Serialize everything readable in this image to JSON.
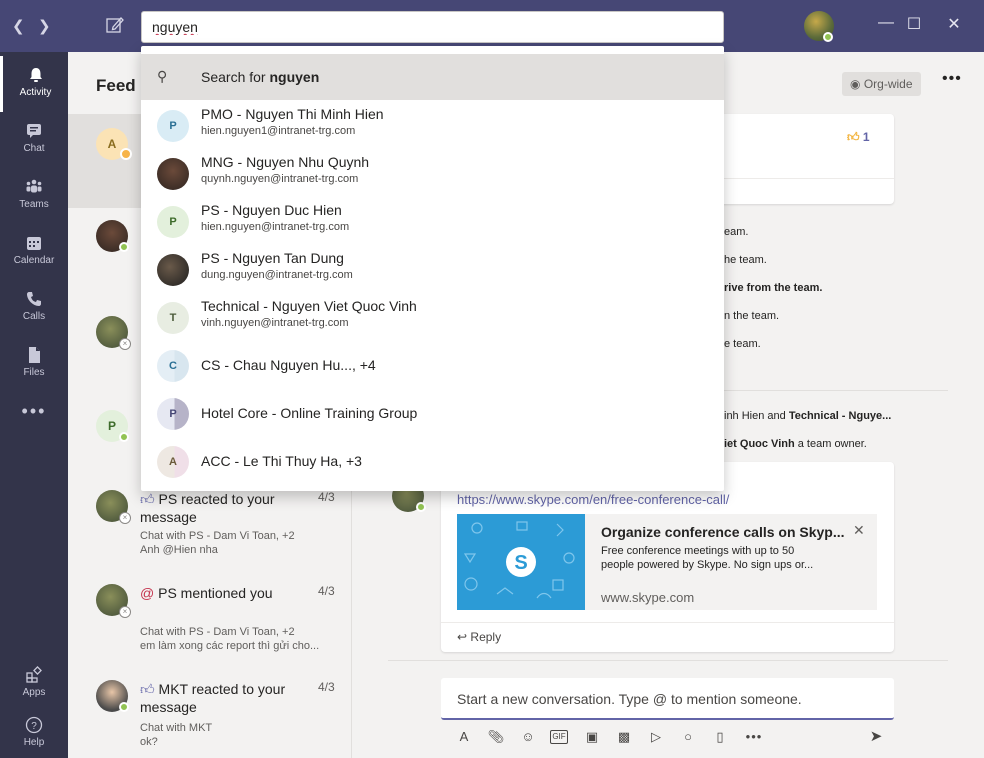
{
  "search": {
    "value": "nguyen"
  },
  "rail": [
    {
      "label": "Activity"
    },
    {
      "label": "Chat"
    },
    {
      "label": "Teams"
    },
    {
      "label": "Calendar"
    },
    {
      "label": "Calls"
    },
    {
      "label": "Files"
    },
    {
      "label": "Apps"
    },
    {
      "label": "Help"
    }
  ],
  "feed": {
    "title": "Feed",
    "items": [
      {
        "initial": "A",
        "title": "",
        "time": "",
        "sub1": "",
        "sub2": ""
      },
      {
        "initial": "",
        "title": "",
        "time": "",
        "sub1": "",
        "sub2": ""
      },
      {
        "initial": "",
        "title": "",
        "time": "",
        "sub1": "",
        "sub2": ""
      },
      {
        "initial": "P",
        "title": "",
        "time": "",
        "sub1": "",
        "sub2": ""
      },
      {
        "initial": "",
        "title": "PS reacted to your message",
        "time": "4/3",
        "sub1": "Chat with PS - Dam Vi Toan, +2",
        "sub2": "Anh @Hien nha"
      },
      {
        "initial": "",
        "title": "PS mentioned you",
        "time": "4/3",
        "sub1": "Chat with PS - Dam Vi Toan, +2",
        "sub2": "em làm xong các report thì gửi cho..."
      },
      {
        "initial": "",
        "title": "MKT reacted to your message",
        "time": "4/3",
        "sub1": "Chat with MKT",
        "sub2": "ok?"
      }
    ]
  },
  "main": {
    "org_wide": "Org-wide",
    "like_count": "1",
    "activity_lines": [
      "eam.",
      "he team.",
      "rive from the team.",
      "n the team.",
      "e team."
    ],
    "owner_line1_pre": "inh Hien and ",
    "owner_line1_b": "Technical - Nguye...",
    "owner_line2_b": "iet Quoc Vinh",
    "owner_line2_post": " a team owner.",
    "link": "https://www.skype.com/en/free-conference-call/",
    "preview_title": "Organize conference calls on Skyp...",
    "preview_desc1": "Free conference meetings with up to 50",
    "preview_desc2": "people powered by Skype. No sign ups or...",
    "preview_domain": "www.skype.com",
    "reply": "Reply",
    "compose_placeholder": "Start a new conversation. Type @ to mention someone."
  },
  "dropdown": {
    "search_prefix": "Search for ",
    "search_term": "nguyen",
    "results": [
      {
        "initial": "P",
        "name": "PMO - Nguyen Thi Minh Hien",
        "email": "hien.nguyen1@intranet-trg.com",
        "color": "#d9ecf5"
      },
      {
        "initial": "",
        "name": "MNG - Nguyen Nhu Quynh",
        "email": "quynh.nguyen@intranet-trg.com",
        "color": "#3a2f2a"
      },
      {
        "initial": "P",
        "name": "PS - Nguyen Duc Hien",
        "email": "hien.nguyen@intranet-trg.com",
        "color": "#e3f0dc"
      },
      {
        "initial": "",
        "name": "PS - Nguyen Tan Dung",
        "email": "dung.nguyen@intranet-trg.com",
        "color": "#2b2b2b"
      },
      {
        "initial": "T",
        "name": "Technical - Nguyen Viet Quoc Vinh",
        "email": "vinh.nguyen@intranet-trg.com",
        "color": "#e8ede2"
      },
      {
        "initial": "C",
        "name": "CS - Chau Nguyen Hu..., +4",
        "email": "",
        "color": "#e4eef5"
      },
      {
        "initial": "P",
        "name": "Hotel Core - Online Training Group",
        "email": "",
        "color": "#e6e8f2"
      },
      {
        "initial": "A",
        "name": "ACC - Le Thi Thuy Ha, +3",
        "email": "",
        "color": "#eee8e2"
      }
    ]
  }
}
